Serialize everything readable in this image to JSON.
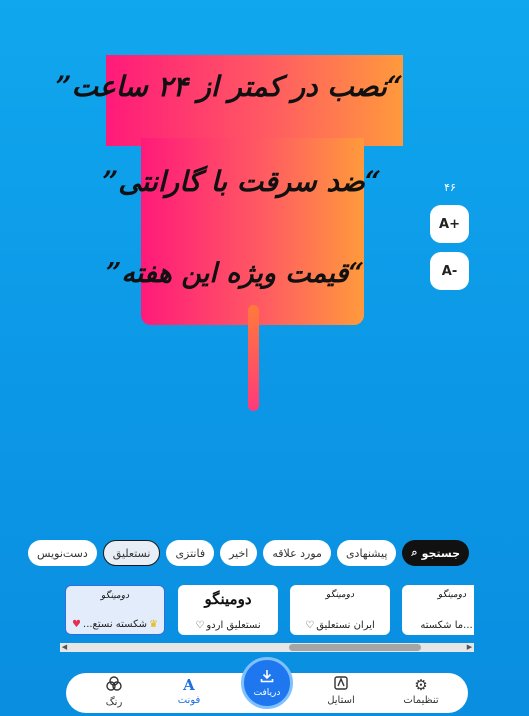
{
  "preview": {
    "line1": "“نصب در کمتر از ۲۴ ساعت”",
    "line2": "“ضد سرقت با گارانتی”",
    "line3": "“قیمت ویژه این هفته”"
  },
  "size_control": {
    "value": "۴۶",
    "increase_label": "A+",
    "decrease_label": "A-"
  },
  "chips": [
    {
      "label": "جستجو",
      "icon": "search-icon"
    },
    {
      "label": "پیشنهادی"
    },
    {
      "label": "مورد علاقه"
    },
    {
      "label": "اخیر"
    },
    {
      "label": "فانتزی"
    },
    {
      "label": "نستعلیق",
      "selected": true
    },
    {
      "label": "دست‌نویس"
    }
  ],
  "font_cards": [
    {
      "sample": "دومینگو",
      "name": "شکسته نستع...",
      "favorite": true,
      "premium": true,
      "selected": true
    },
    {
      "sample": "دومینگو",
      "name": "نستعلیق اردو",
      "favorite": false,
      "premium": false
    },
    {
      "sample": "دومینگو",
      "name": "ایران نستعلیق",
      "favorite": false,
      "premium": false
    },
    {
      "sample": "دومینگو",
      "name": "...ما شکسته",
      "favorite": false,
      "premium": true
    }
  ],
  "bottom_nav": {
    "color": "رنگ",
    "font": "فونت",
    "download": "دریافت",
    "style": "استایل",
    "settings": "تنظیمات"
  },
  "colors": {
    "background": "#10a7ee",
    "gradient_start": "#ff1a7a",
    "gradient_end": "#ff9a3c",
    "accent": "#1f77f0"
  }
}
